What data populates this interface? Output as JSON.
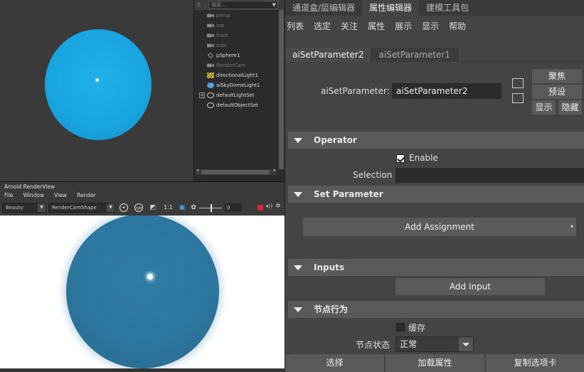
{
  "outliner": {
    "search_placeholder": "搜索...",
    "items": [
      {
        "label": "persp",
        "icon": "camera-icon",
        "dim": true
      },
      {
        "label": "top",
        "icon": "camera-icon",
        "dim": true
      },
      {
        "label": "front",
        "icon": "camera-icon",
        "dim": true
      },
      {
        "label": "side",
        "icon": "camera-icon",
        "dim": true
      },
      {
        "label": "pSphere1",
        "icon": "mesh-icon",
        "dim": false
      },
      {
        "label": "RenderCam",
        "icon": "camera-icon",
        "dim": true
      },
      {
        "label": "directionalLight1",
        "icon": "directional-light-icon",
        "dim": false
      },
      {
        "label": "aiSkyDomeLight1",
        "icon": "skydome-light-icon",
        "dim": false
      },
      {
        "label": "defaultLightSet",
        "icon": "set-icon",
        "dim": false
      },
      {
        "label": "defaultObjectSet",
        "icon": "set-icon",
        "dim": false
      }
    ]
  },
  "render_view": {
    "title": "Arnold RenderView",
    "menu": [
      "File",
      "Window",
      "View",
      "Render"
    ],
    "aov": "Beauty",
    "camera": "RenderCamShape",
    "ratio": "1:1",
    "exposure": "0"
  },
  "ae": {
    "top_tabs": [
      "通道盒/层编辑器",
      "属性编辑器",
      "建模工具包"
    ],
    "active_top_tab": 1,
    "menu": [
      "列表",
      "选定",
      "关注",
      "属性",
      "展示",
      "显示",
      "帮助"
    ],
    "node_tabs": [
      "aiSetParameter2",
      "aiSetParameter1"
    ],
    "param_label": "aiSetParameter:",
    "param_value": "aiSetParameter2",
    "focus_btn": "聚焦",
    "preset_btn": "预设",
    "show_btn": "显示",
    "hide_btn": "隐藏",
    "operator": {
      "title": "Operator",
      "enable_label": "Enable",
      "enable_checked": true,
      "selection_label": "Selection"
    },
    "set_parameter": {
      "title": "Set Parameter",
      "add_assignment": "Add Assignment"
    },
    "inputs": {
      "title": "Inputs",
      "add_input": "Add Input"
    },
    "node_behavior": {
      "title": "节点行为",
      "cache_label": "缓存",
      "cache_checked": false,
      "state_label": "节点状态",
      "state_value": "正常"
    },
    "bottom": {
      "select": "选择",
      "load_attrs": "加载属性",
      "copy_tab": "复制选项卡"
    }
  }
}
